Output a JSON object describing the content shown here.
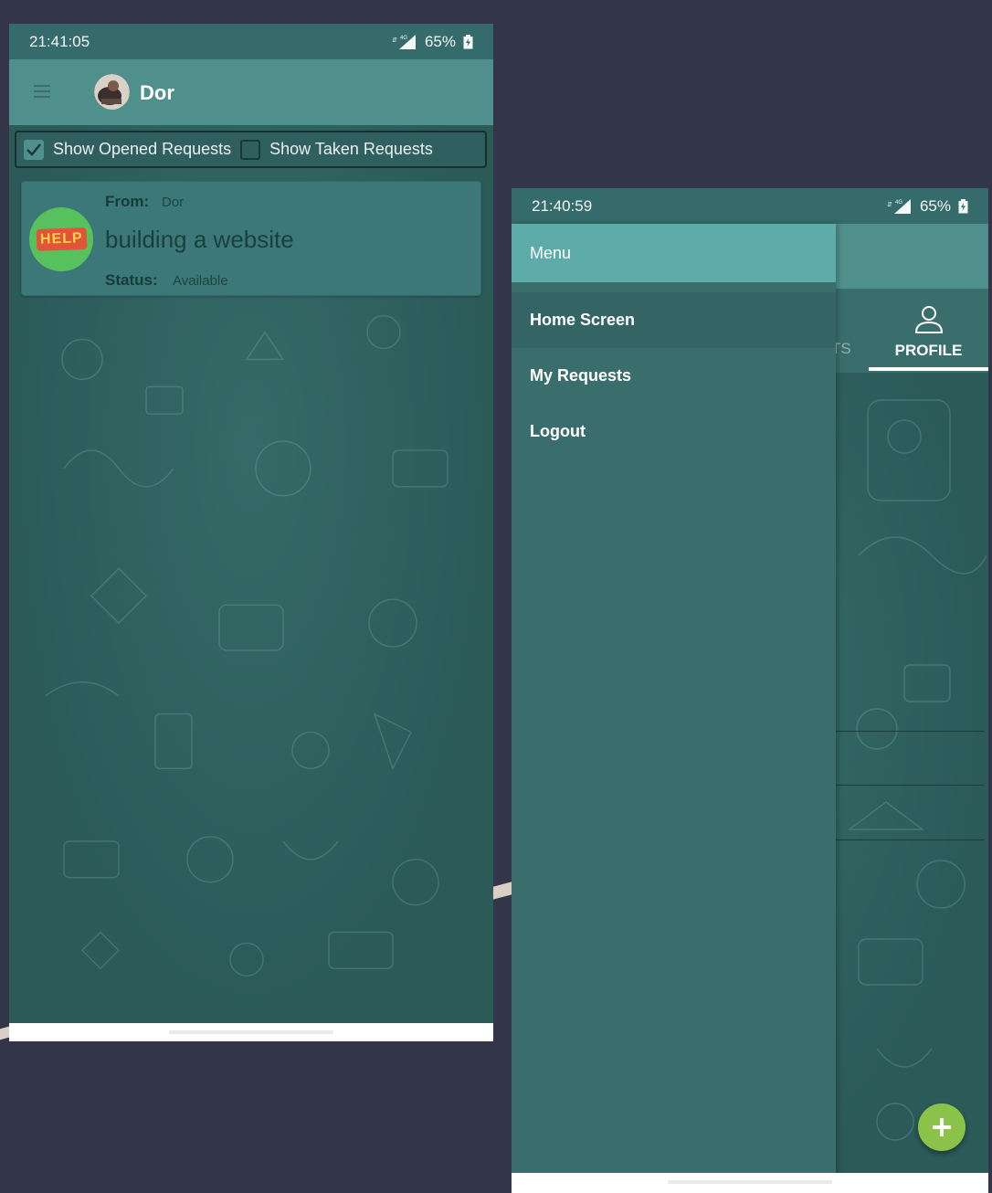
{
  "colors": {
    "background": "#323648",
    "status_bar": "#356c6b",
    "app_bar": "#4f8f8c",
    "drawer": "#3a6e6c",
    "drawer_header": "#5dacaa",
    "fab": "#8bc34a",
    "help_badge": "#57c25d"
  },
  "left_screen": {
    "status_bar": {
      "time": "21:41:05",
      "network": "4G",
      "battery": "65%"
    },
    "app_bar": {
      "menu_icon": "hamburger-icon",
      "avatar": "profile-photo",
      "title": "Dor"
    },
    "filters": {
      "opened": {
        "label": "Show Opened Requests",
        "checked": true
      },
      "taken": {
        "label": "Show Taken Requests",
        "checked": false
      }
    },
    "requests": [
      {
        "badge_text": "HELP",
        "from_label": "From:",
        "from_value": "Dor",
        "title": "building a website",
        "status_label": "Status:",
        "status_value": "Available"
      }
    ]
  },
  "right_screen": {
    "status_bar": {
      "time": "21:40:59",
      "network": "4G",
      "battery": "65%"
    },
    "drawer": {
      "header": "Menu",
      "items": [
        {
          "label": "Home Screen",
          "active": true
        },
        {
          "label": "My Requests",
          "active": false
        },
        {
          "label": "Logout",
          "active": false
        }
      ]
    },
    "tabs": {
      "partial_label": "TS",
      "profile_label": "PROFILE",
      "profile_icon": "person-icon"
    },
    "fab_icon": "plus-icon"
  }
}
